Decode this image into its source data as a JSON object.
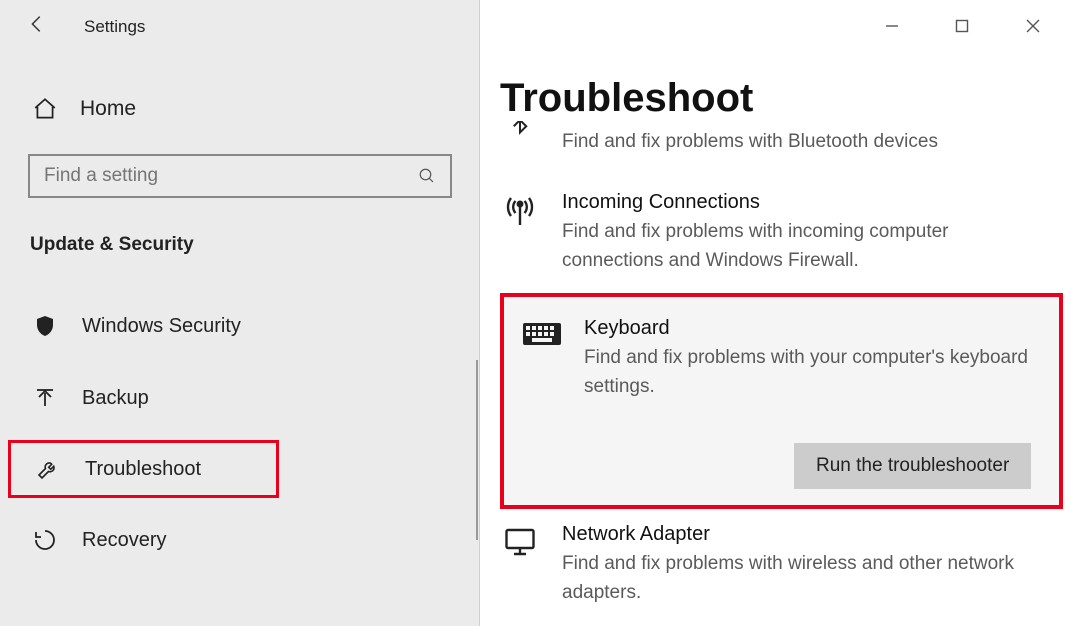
{
  "app": {
    "title": "Settings"
  },
  "home": {
    "label": "Home"
  },
  "search": {
    "placeholder": "Find a setting"
  },
  "section": {
    "header": "Update & Security"
  },
  "nav": [
    {
      "label": "Windows Security"
    },
    {
      "label": "Backup"
    },
    {
      "label": "Troubleshoot"
    },
    {
      "label": "Recovery"
    }
  ],
  "page": {
    "title": "Troubleshoot"
  },
  "troubleshooters": {
    "bluetooth": {
      "desc": "Find and fix problems with Bluetooth devices"
    },
    "incoming": {
      "title": "Incoming Connections",
      "desc": "Find and fix problems with incoming computer connections and Windows Firewall."
    },
    "keyboard": {
      "title": "Keyboard",
      "desc": "Find and fix problems with your computer's keyboard settings.",
      "button": "Run the troubleshooter"
    },
    "network": {
      "title": "Network Adapter",
      "desc": "Find and fix problems with wireless and other network adapters."
    }
  }
}
